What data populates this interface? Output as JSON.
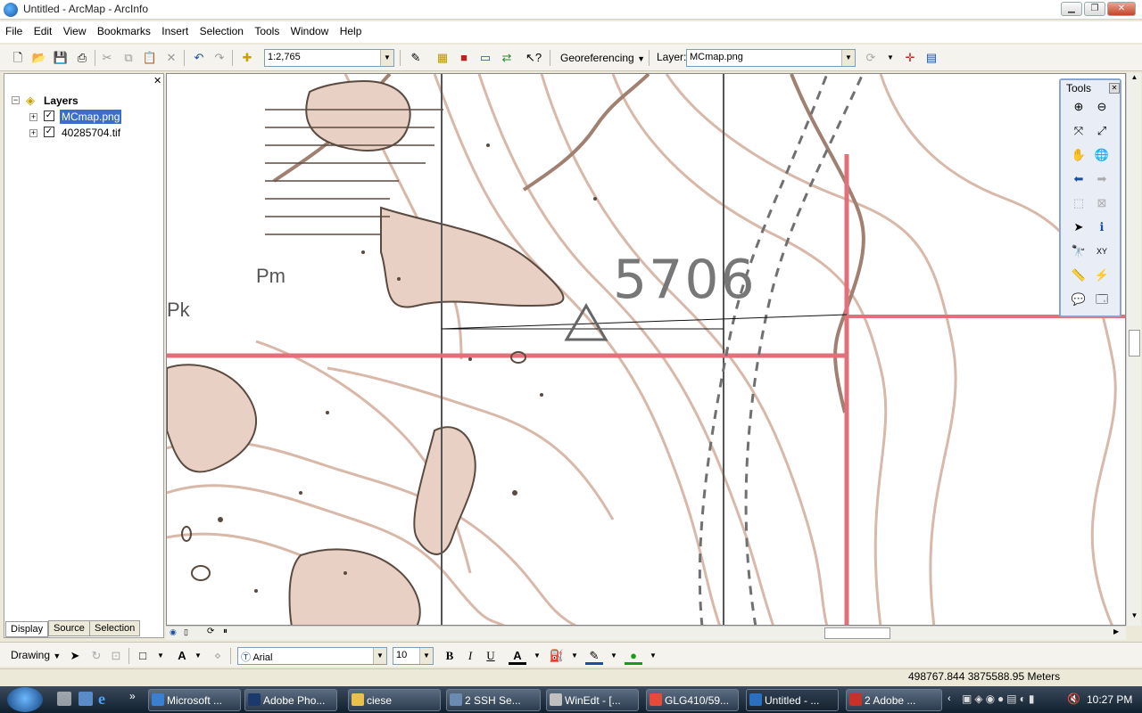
{
  "window": {
    "title": "Untitled - ArcMap - ArcInfo"
  },
  "menu": [
    "File",
    "Edit",
    "View",
    "Bookmarks",
    "Insert",
    "Selection",
    "Tools",
    "Window",
    "Help"
  ],
  "toolbar": {
    "scale_value": "1:2,765",
    "georef_label": "Georeferencing",
    "layer_label": "Layer:",
    "layer_value": "MCmap.png"
  },
  "toc": {
    "root_label": "Layers",
    "layers": [
      {
        "name": "MCmap.png",
        "checked": true,
        "selected": true
      },
      {
        "name": "40285704.tif",
        "checked": true,
        "selected": false
      }
    ],
    "tabs": [
      "Display",
      "Source",
      "Selection"
    ]
  },
  "map": {
    "elevation_label": "5706",
    "unit_label_1": "Pk",
    "unit_label_2": "Pm"
  },
  "tools_palette": {
    "title": "Tools"
  },
  "drawing_toolbar": {
    "drawing_label": "Drawing",
    "font_name": "Arial",
    "font_size": "10",
    "bold": "B",
    "italic": "I",
    "underline": "U"
  },
  "status": {
    "coordinates": "498767.844  3875588.95 Meters"
  },
  "taskbar": {
    "items": [
      {
        "label": "Microsoft ...",
        "color": "#3a7fd0"
      },
      {
        "label": "Adobe Pho...",
        "color": "#1b3a6b"
      },
      {
        "label": "ciese",
        "color": "#e8c04a"
      },
      {
        "label": "2 SSH Se...",
        "color": "#6a8ab0"
      },
      {
        "label": "WinEdt - [...",
        "color": "#c0c0c0"
      },
      {
        "label": "GLG410/59...",
        "color": "#e64a3a"
      },
      {
        "label": "Untitled - ...",
        "color": "#2b6fc0"
      },
      {
        "label": "2 Adobe ...",
        "color": "#c8302a"
      }
    ],
    "clock": "10:27 PM"
  }
}
